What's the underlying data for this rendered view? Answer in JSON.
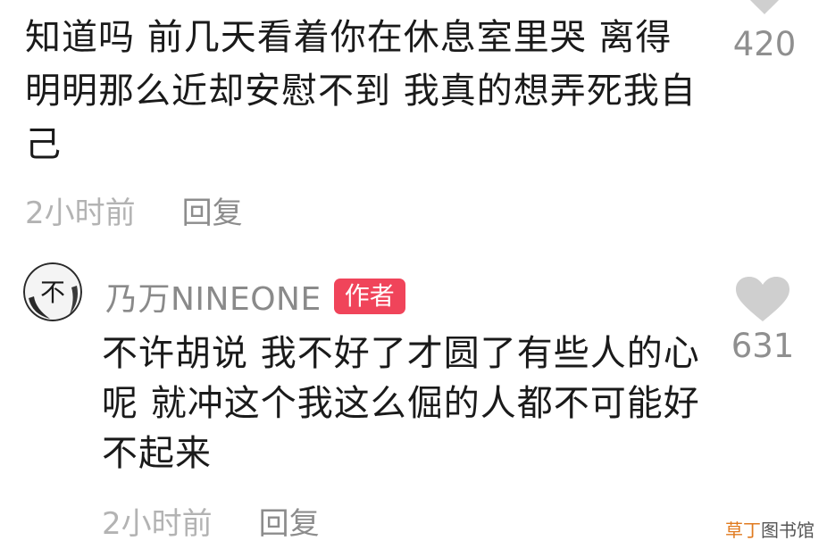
{
  "comments": [
    {
      "text": "知道吗 前几天看着你在休息室里哭 离得明明那么近却安慰不到 我真的想弄死我自己",
      "time": "2小时前",
      "reply_label": "回复",
      "like_count": "420",
      "like_icon": "heart-icon"
    },
    {
      "username": "乃万NINEONE",
      "badge": "作者",
      "avatar_glyph": "不",
      "text": "不许胡说 我不好了才圆了有些人的心呢 就冲这个我这么倔的人都不可能好不起来",
      "time": "2小时前",
      "reply_label": "回复",
      "like_count": "631",
      "like_icon": "heart-icon"
    }
  ],
  "watermark": {
    "accent": "草丁",
    "rest": "图书馆"
  },
  "colors": {
    "badge_bg": "#f0445a",
    "heart": "#cfcfcf",
    "meta_text": "#b3b3b3"
  }
}
